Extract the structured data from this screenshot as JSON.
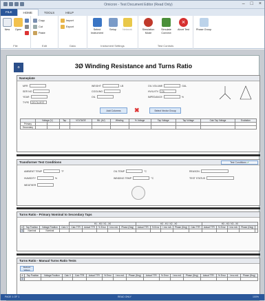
{
  "window": {
    "title": "Omicron - Test Document Editor (Read Only)"
  },
  "tabs": [
    "FILE",
    "HOME",
    "TOOLS",
    "HELP"
  ],
  "ribbon": {
    "groups": [
      {
        "name": "File",
        "buttons": [
          "New",
          "Open"
        ],
        "small": []
      },
      {
        "name": "Edit",
        "buttons": [],
        "small": [
          "Copy",
          "Cut",
          "Paste"
        ]
      },
      {
        "name": "Data",
        "buttons": [],
        "small": [
          "Import",
          "Export"
        ]
      },
      {
        "name": "Instrument Settings",
        "buttons": [
          "Select Instrument",
          "Setup",
          "Network"
        ],
        "small": []
      },
      {
        "name": "Test Controls",
        "buttons": [
          "Simulation Mode",
          "Simulate Connect",
          "Abort Test"
        ],
        "small": []
      },
      {
        "name": "",
        "buttons": [
          "Phase Group"
        ],
        "small": []
      }
    ]
  },
  "page": {
    "title": "3Ø Winding Resistance and Turns Ratio",
    "nameplate": {
      "header": "Nameplate",
      "fields_left": [
        "MFR",
        "SER NO",
        "YEAR",
        "TYPE"
      ],
      "type_value": "DELTA-WYE",
      "fields_mid": [
        "WEIGHT",
        "COOLING",
        "OIL"
      ],
      "fields_right": [
        "OIL VOLUME",
        "HV/LV/TV",
        "IMPEDANCE"
      ],
      "oil_unit": "GAL",
      "kva_value": "OIL",
      "weight_unit": "LB",
      "imp_unit": "%",
      "btn_add": "Add Columns",
      "btn_select": "Select Vector Group",
      "table_headers": [
        "Voltage (V)",
        "Tap",
        "VOLTAGE",
        "BIL (kV)",
        "Winding",
        "% Voltage",
        "Tap Voltage",
        "Tap Voltage",
        "Calc Tap Voltage",
        "Excitation"
      ],
      "row_labels": [
        "Primary",
        "Secondary"
      ]
    },
    "test_conditions": {
      "header": "Transformer Test Conditions",
      "btn": "Test Conditions",
      "fields": [
        "AMBIENT TEMP",
        "HUMIDITY",
        "WEATHER",
        "OIL TEMP",
        "WINDING TEMP",
        "REASON",
        "TEST STATUS"
      ],
      "units": [
        "°F",
        "%",
        "",
        "°C",
        "°C",
        "",
        ""
      ]
    },
    "turns_primary": {
      "header": "Turns Ratio - Primary Nominal to Secondary Taps",
      "groups": [
        "H1 - H3 / X1 - X0",
        "H2 - H1 / X2 - X0",
        "H3 - H2 / X3 - X0"
      ],
      "cols": [
        "#",
        "Tap Position",
        "Voltage Position",
        "Calc V",
        "Calc TTR",
        "Actual TTR",
        "% Error",
        "I exc mA",
        "Phase (Deg)"
      ],
      "row": [
        "1",
        "Nominal",
        "Nominal"
      ]
    },
    "turns_manual": {
      "header": "Turns Ratio - Manual Turns Ratio Tests",
      "btn": "Refresh Values",
      "cols": [
        "#",
        "Tap Position",
        "Voltage Position",
        "Calc V",
        "Calc TTR",
        "Actual TTR",
        "% Error",
        "I exc mA",
        "Phase (Deg)"
      ],
      "row": [
        "1"
      ]
    }
  },
  "status": {
    "left": "PAGE 1 OF 1",
    "mid": "READ ONLY",
    "right": "100%"
  }
}
